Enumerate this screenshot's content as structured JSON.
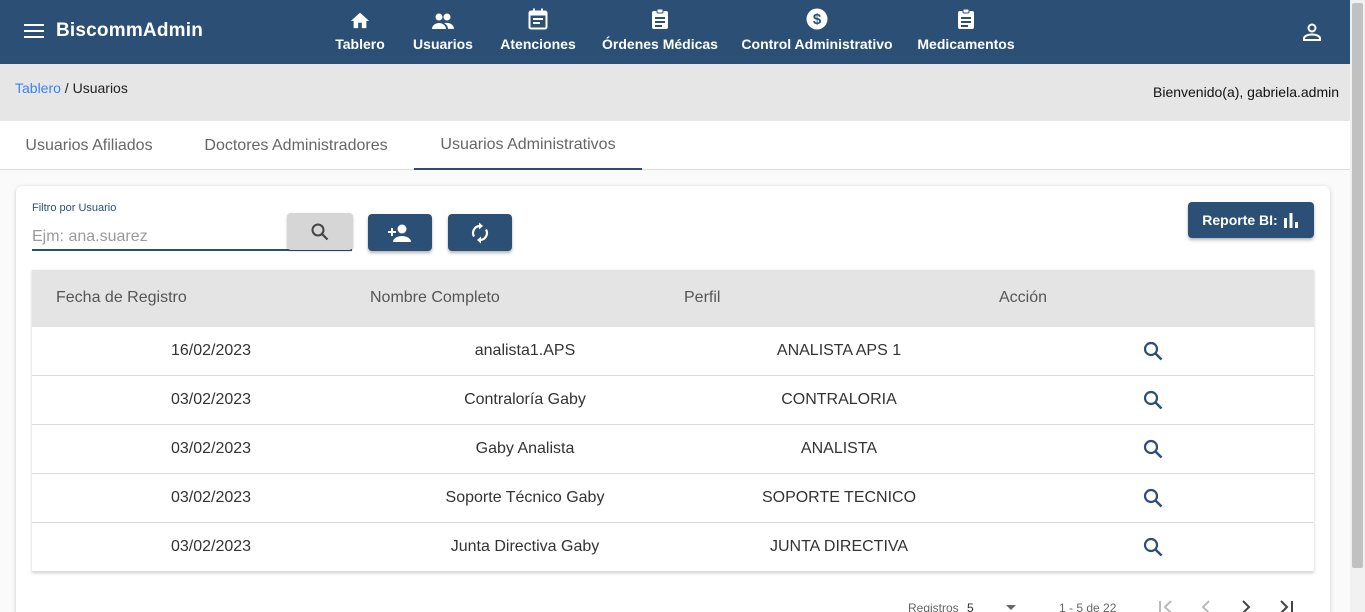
{
  "app": {
    "title": "BiscommAdmin"
  },
  "nav": [
    {
      "label": "Tablero",
      "icon": "home-icon"
    },
    {
      "label": "Usuarios",
      "icon": "people-icon"
    },
    {
      "label": "Atenciones",
      "icon": "calendar-icon"
    },
    {
      "label": "Órdenes Médicas",
      "icon": "clipboard-icon"
    },
    {
      "label": "Control Administrativo",
      "icon": "dollar-circle-icon"
    },
    {
      "label": "Medicamentos",
      "icon": "clipboard-icon"
    }
  ],
  "breadcrumb": {
    "root": "Tablero",
    "separator": " / ",
    "current": "Usuarios"
  },
  "welcome": "Bienvenido(a), gabriela.admin",
  "tabs": [
    {
      "label": "Usuarios Afiliados",
      "active": false
    },
    {
      "label": "Doctores Administradores",
      "active": false
    },
    {
      "label": "Usuarios Administrativos",
      "active": true
    }
  ],
  "filter": {
    "label": "Filtro por Usuario",
    "placeholder": "Ejm: ana.suarez",
    "value": ""
  },
  "report_button": {
    "label": "Reporte BI:"
  },
  "table": {
    "headers": [
      "Fecha de Registro",
      "Nombre Completo",
      "Perfil",
      "Acción"
    ],
    "rows": [
      {
        "date": "16/02/2023",
        "name": "analista1.APS",
        "profile": "ANALISTA APS 1"
      },
      {
        "date": "03/02/2023",
        "name": "Contraloría Gaby",
        "profile": "CONTRALORIA"
      },
      {
        "date": "03/02/2023",
        "name": "Gaby Analista",
        "profile": "ANALISTA"
      },
      {
        "date": "03/02/2023",
        "name": "Soporte Técnico Gaby",
        "profile": "SOPORTE TECNICO"
      },
      {
        "date": "03/02/2023",
        "name": "Junta Directiva Gaby",
        "profile": "JUNTA DIRECTIVA"
      }
    ]
  },
  "paginator": {
    "label": "Registros",
    "page_size": "5",
    "range": "1 - 5 de 22"
  },
  "colors": {
    "primary": "#2c4f76",
    "link": "#3b82f6"
  }
}
